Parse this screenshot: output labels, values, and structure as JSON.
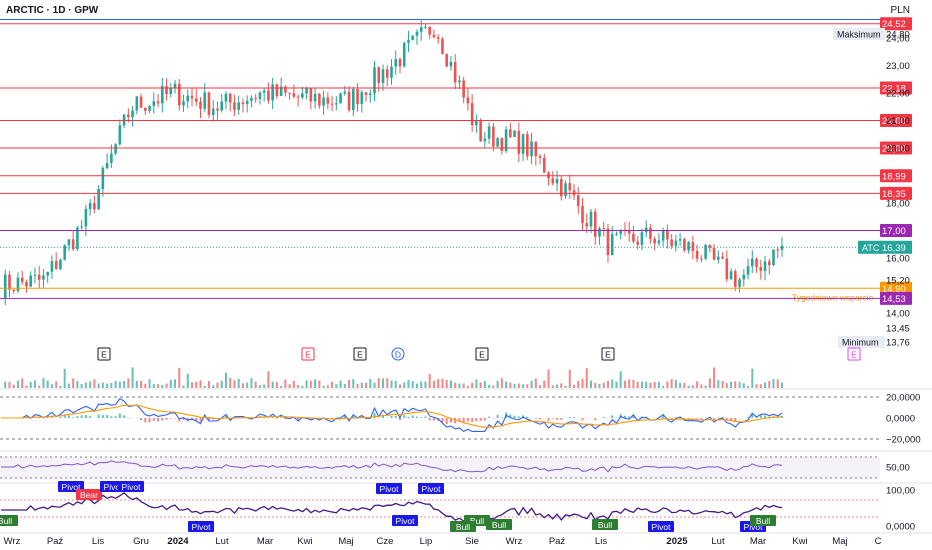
{
  "header": {
    "symbol": "ARCTIC · 1D · GPW",
    "currency": "PLN"
  },
  "colors": {
    "up": "#26a69a",
    "down": "#ef5350",
    "resistance": "#f23645",
    "purple": "#9c27b0",
    "support": "#ff9800",
    "blue": "#2962ff",
    "orange": "#ff9800",
    "osc": "#7e57c2"
  },
  "chart_data": {
    "type": "candlestick",
    "price_axis": {
      "ticks": [
        "24,00",
        "23,00",
        "22,00",
        "21,00",
        "20,00",
        "18,00",
        "16,00",
        "15,20",
        "14,00",
        "13,45"
      ]
    },
    "time_axis": {
      "ticks": [
        "Wrz",
        "Paź",
        "Lis",
        "Gru",
        "2024",
        "Lut",
        "Mar",
        "Kwi",
        "Maj",
        "Cze",
        "Lip",
        "Sie",
        "Wrz",
        "Paź",
        "Lis",
        "2025",
        "Lut",
        "Mar",
        "Kwi",
        "Maj",
        "C"
      ]
    },
    "levels": [
      {
        "value": 24.52,
        "label": "24,52",
        "kind": "resistance"
      },
      {
        "value": 22.18,
        "label": "22,18",
        "kind": "resistance"
      },
      {
        "value": 21.0,
        "label": "21,00",
        "kind": "resistance"
      },
      {
        "value": 20.0,
        "label": "20,00",
        "kind": "resistance"
      },
      {
        "value": 18.99,
        "label": "18,99",
        "kind": "resistance"
      },
      {
        "value": 18.35,
        "label": "18,35",
        "kind": "resistance"
      },
      {
        "value": 17.0,
        "label": "17,00",
        "kind": "purple"
      },
      {
        "value": 14.9,
        "label": "14,90",
        "kind": "support",
        "note": "Tygodniowe wsparcie"
      },
      {
        "value": 14.53,
        "label": "14,53",
        "kind": "purple"
      }
    ],
    "max": {
      "label": "Maksimum",
      "value": "24,80"
    },
    "min": {
      "label": "Minimum",
      "value": "13,76"
    },
    "last": {
      "ticker": "ATC",
      "value": "16,39"
    },
    "key_prices": [
      {
        "month": "Wrz",
        "price": 15.0
      },
      {
        "month": "Paź",
        "price": 15.2
      },
      {
        "month": "Lis",
        "price": 17.5
      },
      {
        "month": "Gru",
        "price": 21.5
      },
      {
        "month": "2024",
        "price": 22.0
      },
      {
        "month": "Lut",
        "price": 21.5
      },
      {
        "month": "Mar",
        "price": 22.0
      },
      {
        "month": "Kwi",
        "price": 21.8
      },
      {
        "month": "Maj",
        "price": 21.7
      },
      {
        "month": "Cze",
        "price": 23.0
      },
      {
        "month": "Lip",
        "price": 24.5
      },
      {
        "month": "Sie",
        "price": 20.5
      },
      {
        "month": "Wrz",
        "price": 20.2
      },
      {
        "month": "Paź",
        "price": 18.5
      },
      {
        "month": "Lis",
        "price": 16.5
      },
      {
        "month": "2025",
        "price": 16.8
      },
      {
        "month": "Lut",
        "price": 16.3
      },
      {
        "month": "Mar",
        "price": 15.2
      },
      {
        "month": "end",
        "price": 16.39
      }
    ],
    "event_markers": [
      "E",
      "E",
      "E",
      "D",
      "E",
      "E",
      "E"
    ],
    "macd": {
      "ticks": [
        "20,0000",
        "0,0000",
        "−20,000"
      ]
    },
    "rsi": {
      "ticks": [
        "50,00"
      ]
    },
    "osc": {
      "ticks": [
        "100,00",
        "0,0000"
      ]
    },
    "osc_labels": [
      {
        "text": "Pivot",
        "kind": "pivot-high"
      },
      {
        "text": "Bear",
        "kind": "bear"
      },
      {
        "text": "Pivot",
        "kind": "pivot-high"
      },
      {
        "text": "Pivot",
        "kind": "pivot-high"
      },
      {
        "text": "Bull",
        "kind": "bull"
      },
      {
        "text": "Pivot",
        "kind": "pivot-low"
      },
      {
        "text": "Pivot",
        "kind": "pivot-high"
      },
      {
        "text": "Pivot",
        "kind": "pivot-high"
      },
      {
        "text": "Pivot",
        "kind": "pivot-low"
      },
      {
        "text": "Bull",
        "kind": "bull"
      },
      {
        "text": "Bull",
        "kind": "bull"
      },
      {
        "text": "Bull",
        "kind": "bull"
      },
      {
        "text": "Bull",
        "kind": "bull"
      },
      {
        "text": "Pivot",
        "kind": "pivot-high"
      },
      {
        "text": "Pivot",
        "kind": "pivot-low"
      },
      {
        "text": "Bull",
        "kind": "bull"
      }
    ]
  }
}
